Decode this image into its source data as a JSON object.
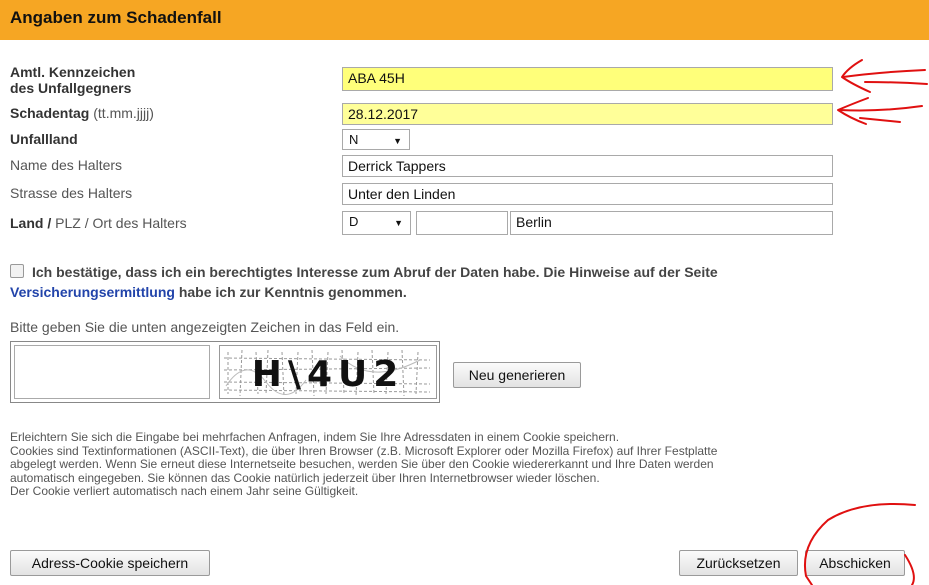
{
  "header": {
    "title": "Angaben zum Schadenfall"
  },
  "form": {
    "plate_label_bold_1": "Amtl. Kennzeichen",
    "plate_label_bold_2": "des Unfallgegners",
    "plate_value": "ABA 45H",
    "date_label_bold": "Schadentag",
    "date_label_hint": " (tt.mm.jjjj)",
    "date_value": "28.12.2017",
    "country_label": "Unfallland",
    "country_value": "N",
    "owner_name_label": "Name des Halters",
    "owner_name_value": "Derrick Tappers",
    "owner_street_label": "Strasse des Halters",
    "owner_street_value": "Unter den Linden",
    "owner_location_label_bold": "Land /",
    "owner_location_label_rest": " PLZ / Ort des Halters",
    "owner_country_value": "D",
    "owner_zip_value": "",
    "owner_city_value": "Berlin"
  },
  "confirm": {
    "text_1": "Ich bestätige, dass ich ein berechtigtes Interesse zum Abruf der Daten habe. Die Hinweise auf der Seite",
    "link": "Versicherungsermittlung",
    "text_2": " habe ich zur Kenntnis genommen.",
    "checked": false
  },
  "captcha": {
    "hint": "Bitte geben Sie die unten angezeigten Zeichen in das Feld ein.",
    "value": "",
    "image_text": "H\\4U2",
    "regenerate_label": "Neu generieren"
  },
  "cookie_info": {
    "line_1": "Erleichtern Sie sich die Eingabe bei mehrfachen Anfragen, indem Sie Ihre Adressdaten in einem Cookie speichern.",
    "line_2": "Cookies sind Textinformationen (ASCII-Text), die über Ihren Browser (z.B. Microsoft Explorer oder Mozilla Firefox) auf Ihrer Festplatte",
    "line_3": "abgelegt werden. Wenn Sie erneut diese Internetseite besuchen, werden Sie über den Cookie wiedererkannt und Ihre Daten werden",
    "line_4": "automatisch eingegeben. Sie können das Cookie natürlich jederzeit über Ihren Internetbrowser wieder löschen.",
    "line_5": "Der Cookie verliert automatisch nach einem Jahr seine Gültigkeit."
  },
  "buttons": {
    "save_cookie": "Adress-Cookie speichern",
    "reset": "Zurücksetzen",
    "submit": "Abschicken"
  },
  "colors": {
    "header_bg": "#f6a623",
    "highlight": "#ffff7a",
    "annotation": "#e01010",
    "link": "#2244aa"
  }
}
